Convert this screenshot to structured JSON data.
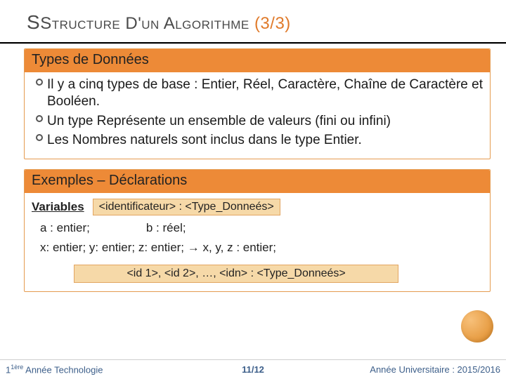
{
  "header": {
    "title_sc1": "Structure",
    "title_mid1": " D'",
    "title_sc2": "un",
    "title_mid2": " A",
    "title_sc3": "lgorithme",
    "page_frac": "(3/3)"
  },
  "panel_types": {
    "heading": "Types de Données",
    "bullets": [
      "Il y a cinq types de base : Entier, Réel, Caractère, Chaîne de Caractère et Booléen.",
      "Un type Représente un ensemble de valeurs (fini ou infini)",
      "Les Nombres naturels sont inclus dans le type Entier."
    ]
  },
  "panel_examples": {
    "heading": "Exemples – Déclarations",
    "variables_label": "Variables",
    "syntax1": "<identificateur> : <Type_Donneés>",
    "decl_a": "a : entier;",
    "decl_b": "b : réel;",
    "decl_line": "x: entier; y: entier; z: entier;   →  x, y, z : entier;",
    "syntax2": "<id 1>, <id 2>, …, <idn> : <Type_Donneés>"
  },
  "footer": {
    "left_sup": "1ère",
    "left_rest": " Année Technologie",
    "center": "11/12",
    "right": "Année Universitaire : 2015/2016"
  }
}
